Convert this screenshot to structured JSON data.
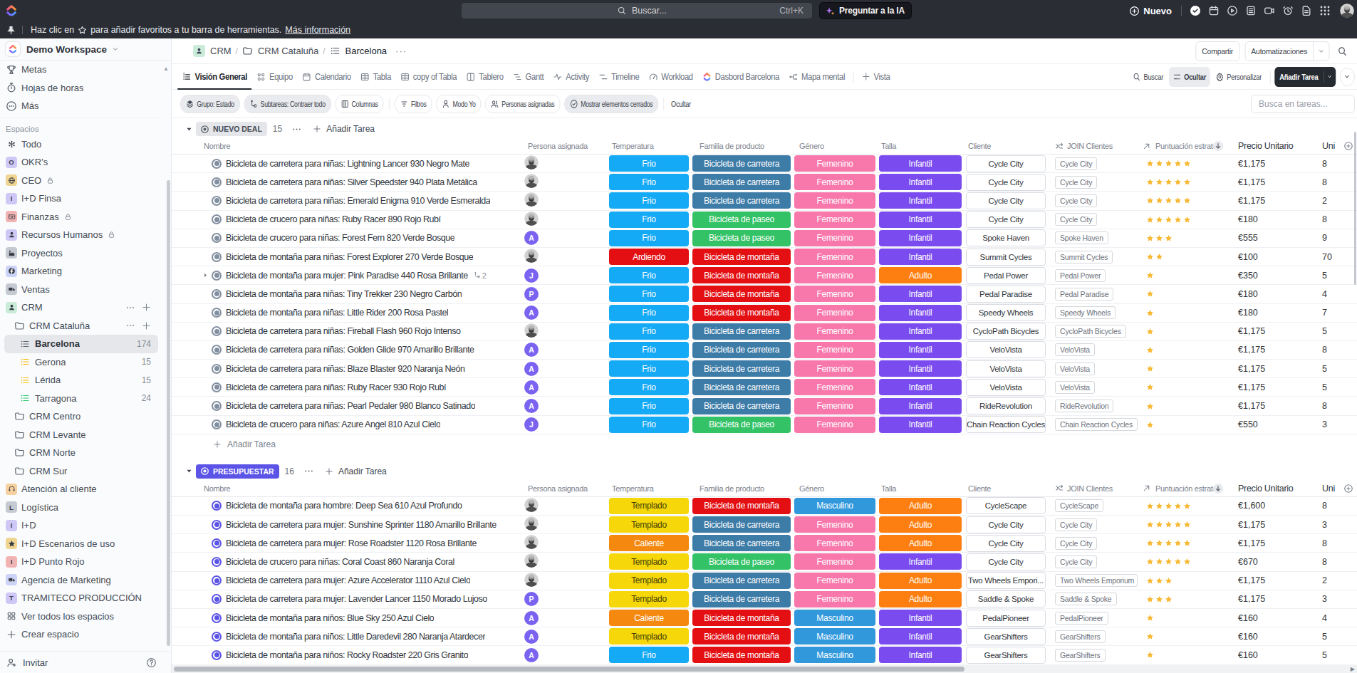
{
  "topbar": {
    "search_placeholder": "Buscar...",
    "search_shortcut": "Ctrl+K",
    "ask_ai_label": "Preguntar a la IA",
    "new_label": "Nuevo",
    "icons": [
      "check-circle-icon",
      "calendar-icon",
      "play-circle-icon",
      "notes-icon",
      "video-icon",
      "alarm-icon",
      "doc-icon",
      "grid-icon"
    ]
  },
  "favorites_bar": {
    "text_before_star": "Haz clic en",
    "text_after_star": "para añadir favoritos a tu barra de herramientas.",
    "link_label": "Más información"
  },
  "sidebar": {
    "workspace_name": "Demo Workspace",
    "top_items": [
      {
        "label": "Metas",
        "icon": "trophy"
      },
      {
        "label": "Hojas de horas",
        "icon": "stopwatch"
      },
      {
        "label": "Más",
        "icon": "dots-circle"
      }
    ],
    "section_label": "Espacios",
    "items": [
      {
        "type": "space",
        "label": "Todo",
        "icon": "everything"
      },
      {
        "type": "space",
        "label": "OKR's",
        "letter": "O",
        "bg": "#cfc8f6"
      },
      {
        "type": "space",
        "label": "CEO",
        "icon": "globe",
        "bg": "#f0d491",
        "lock": true
      },
      {
        "type": "space",
        "label": "I+D Finsa",
        "letter": "I",
        "bg": "#cfc8f6"
      },
      {
        "type": "space",
        "label": "Finanzas",
        "icon": "banknote",
        "bg": "#f2b3b3",
        "lock": true
      },
      {
        "type": "space",
        "label": "Recursos Humanos",
        "icon": "person",
        "bg": "#cfc8f6",
        "lock": true
      },
      {
        "type": "space",
        "label": "Proyectos",
        "icon": "factory",
        "bg": "#c4c9d2"
      },
      {
        "type": "space",
        "label": "Marketing",
        "icon": "facebook",
        "bg": "#ccd3f8"
      },
      {
        "type": "space",
        "label": "Ventas",
        "icon": "truck",
        "bg": "#c4c9d2"
      },
      {
        "type": "space",
        "label": "CRM",
        "icon": "person",
        "bg": "#c9ebd8",
        "actions": true
      },
      {
        "type": "folder",
        "label": "CRM Cataluña",
        "actions": true
      },
      {
        "type": "list",
        "label": "Barcelona",
        "count": "174",
        "color": "#5d646f",
        "selected": true
      },
      {
        "type": "list",
        "label": "Gerona",
        "count": "15",
        "color": "#f6b900"
      },
      {
        "type": "list",
        "label": "Lérida",
        "count": "15",
        "color": "#f6b900"
      },
      {
        "type": "list",
        "label": "Tarragona",
        "count": "24",
        "color": "#2cc56e"
      },
      {
        "type": "folder",
        "label": "CRM Centro"
      },
      {
        "type": "folder",
        "label": "CRM Levante"
      },
      {
        "type": "folder",
        "label": "CRM Norte"
      },
      {
        "type": "folder",
        "label": "CRM Sur"
      },
      {
        "type": "space",
        "label": "Atención al cliente",
        "icon": "headset",
        "bg": "#f6cf9e"
      },
      {
        "type": "space",
        "label": "Logística",
        "letter": "L",
        "bg": "#c4c9d2"
      },
      {
        "type": "space",
        "label": "I+D",
        "letter": "I",
        "bg": "#cfc8f6"
      },
      {
        "type": "space",
        "label": "I+D Escenarios de uso",
        "icon": "star",
        "bg": "#f0d491"
      },
      {
        "type": "space",
        "label": "I+D Punto Rojo",
        "letter": "I",
        "bg": "#f2b3b3"
      },
      {
        "type": "space",
        "label": "Agencia de Marketing",
        "icon": "truck",
        "bg": "#ccd3f8"
      },
      {
        "type": "space",
        "label": "TRAMITECO PRODUCCIÓN",
        "letter": "T",
        "bg": "#cfc8f6"
      },
      {
        "type": "action",
        "label": "Ver todos los espacios",
        "icon": "grid-small"
      },
      {
        "type": "action",
        "label": "Crear espacio",
        "icon": "plus"
      }
    ],
    "invite_label": "Invitar"
  },
  "breadcrumb": {
    "items": [
      {
        "label": "CRM",
        "icon": "person",
        "bg": "#c9ebd8"
      },
      {
        "label": "CRM Cataluña",
        "icon": "folder"
      },
      {
        "label": "Barcelona",
        "icon": "list"
      }
    ],
    "share_label": "Compartir",
    "automations_label": "Automatizaciones"
  },
  "tabs": [
    {
      "label": "Visión General",
      "icon": "overview",
      "active": true
    },
    {
      "label": "Equipo",
      "icon": "team"
    },
    {
      "label": "Calendario",
      "icon": "calendar"
    },
    {
      "label": "Tabla",
      "icon": "table"
    },
    {
      "label": "copy of Tabla",
      "icon": "table"
    },
    {
      "label": "Tablero",
      "icon": "board"
    },
    {
      "label": "Gantt",
      "icon": "gantt"
    },
    {
      "label": "Activity",
      "icon": "activity"
    },
    {
      "label": "Timeline",
      "icon": "timeline"
    },
    {
      "label": "Workload",
      "icon": "workload"
    },
    {
      "label": "Dasbord Barcelona",
      "icon": "clickup"
    },
    {
      "label": "Mapa mental",
      "icon": "mindmap"
    }
  ],
  "tabs_add_label": "Vista",
  "view_toolbar": {
    "search_label": "Buscar",
    "hide_label": "Ocultar",
    "customize_label": "Personalizar",
    "add_task_label": "Añadir Tarea"
  },
  "filter_bar": {
    "pills": [
      {
        "label": "Grupo: Estado",
        "icon": "layers",
        "grey": true
      },
      {
        "label": "Subtareas: Contraer todo",
        "icon": "subtask",
        "grey": true
      },
      {
        "label": "Columnas",
        "icon": "columns",
        "grey": false
      }
    ],
    "buttons": [
      {
        "label": "Filtros",
        "icon": "filter"
      },
      {
        "label": "Modo Yo",
        "icon": "person-o"
      },
      {
        "label": "Personas asignadas",
        "icon": "people"
      },
      {
        "label": "Mostrar elementos cerrados",
        "icon": "check-circle",
        "grey": true
      }
    ],
    "hide_label": "Ocultar",
    "task_search_placeholder": "Busca en tareas..."
  },
  "table": {
    "columns": [
      "Nombre",
      "Persona asignada",
      "Temperatura",
      "Familia de producto",
      "Género",
      "Talla",
      "Cliente",
      "JOIN Clientes",
      "Puntuación estraté...",
      "Precio Unitario",
      "Uni"
    ],
    "add_task_label": "Añadir Tarea",
    "pill_colors": {
      "Frio": "#15aaf5",
      "Ardiendo": "#e30f13",
      "Templado": "#f5d70a",
      "Caliente": "#f5880f",
      "Bicicleta de carretera": "#3e7ca8",
      "Bicicleta de paseo": "#33c266",
      "Bicicleta de montaña": "#e30f13",
      "Femenino": "#f878ac",
      "Masculino": "#3298dc",
      "Infantil": "#7a4bef",
      "Adulto": "#fd7f11"
    },
    "groups": [
      {
        "name": "NUEVO DEAL",
        "count": "15",
        "pill_bg": "#e4e6ea",
        "pill_fg": "#454c56",
        "status_color": "#828fa0",
        "rows": [
          {
            "name": "Bicicleta de carretera para niñas: Lightning Lancer 930 Negro Mate",
            "avatar": "photo",
            "temp": "Frio",
            "fam": "Bicicleta de carretera",
            "gen": "Femenino",
            "talla": "Infantil",
            "cliente": "Cycle City",
            "join": "Cycle City",
            "stars": 5,
            "precio": "€1,175",
            "uni": "8"
          },
          {
            "name": "Bicicleta de carretera para niñas: Silver Speedster 940 Plata Metálica",
            "avatar": "photo",
            "temp": "Frio",
            "fam": "Bicicleta de carretera",
            "gen": "Femenino",
            "talla": "Infantil",
            "cliente": "Cycle City",
            "join": "Cycle City",
            "stars": 5,
            "precio": "€1,175",
            "uni": "8"
          },
          {
            "name": "Bicicleta de carretera para niñas: Emerald Enigma 910 Verde Esmeralda",
            "avatar": "photo",
            "temp": "Frio",
            "fam": "Bicicleta de carretera",
            "gen": "Femenino",
            "talla": "Infantil",
            "cliente": "Cycle City",
            "join": "Cycle City",
            "stars": 5,
            "precio": "€1,175",
            "uni": "2"
          },
          {
            "name": "Bicicleta de crucero para niñas: Ruby Racer 890 Rojo Rubí",
            "avatar": "photo",
            "temp": "Frio",
            "fam": "Bicicleta de paseo",
            "gen": "Femenino",
            "talla": "Infantil",
            "cliente": "Cycle City",
            "join": "Cycle City",
            "stars": 5,
            "precio": "€180",
            "uni": "8"
          },
          {
            "name": "Bicicleta de crucero para niñas: Forest Fern 820 Verde Bosque",
            "avatar": "A",
            "temp": "Frio",
            "fam": "Bicicleta de paseo",
            "gen": "Femenino",
            "talla": "Infantil",
            "cliente": "Spoke Haven",
            "join": "Spoke Haven",
            "stars": 3,
            "precio": "€555",
            "uni": "9"
          },
          {
            "name": "Bicicleta de montaña para niñas: Forest Explorer 270 Verde Bosque",
            "avatar": "photo",
            "temp": "Ardiendo",
            "fam": "Bicicleta de montaña",
            "gen": "Femenino",
            "talla": "Infantil",
            "cliente": "Summit Cycles",
            "join": "Summit Cycles",
            "stars": 2,
            "precio": "€100",
            "uni": "70"
          },
          {
            "name": "Bicicleta de montaña para mujer: Pink Paradise 440 Rosa Brillante",
            "avatar": "J",
            "expand": true,
            "subtasks": "2",
            "temp": "Frio",
            "fam": "Bicicleta de montaña",
            "gen": "Femenino",
            "talla": "Adulto",
            "cliente": "Pedal Power",
            "join": "Pedal Power",
            "stars": 1,
            "precio": "€350",
            "uni": "5"
          },
          {
            "name": "Bicicleta de montaña para niñas: Tiny Trekker 230 Negro Carbón",
            "avatar": "P",
            "temp": "Frio",
            "fam": "Bicicleta de montaña",
            "gen": "Femenino",
            "talla": "Infantil",
            "cliente": "Pedal Paradise",
            "join": "Pedal Paradise",
            "stars": 1,
            "precio": "€180",
            "uni": "4"
          },
          {
            "name": "Bicicleta de montaña para niñas: Little Rider 200 Rosa Pastel",
            "avatar": "A",
            "temp": "Frio",
            "fam": "Bicicleta de montaña",
            "gen": "Femenino",
            "talla": "Infantil",
            "cliente": "Speedy Wheels",
            "join": "Speedy Wheels",
            "stars": 1,
            "precio": "€180",
            "uni": "7"
          },
          {
            "name": "Bicicleta de carretera para niñas: Fireball Flash 960 Rojo Intenso",
            "avatar": "photo",
            "temp": "Frio",
            "fam": "Bicicleta de carretera",
            "gen": "Femenino",
            "talla": "Infantil",
            "cliente": "CycloPath Bicycles",
            "join": "CycloPath Bicycles",
            "stars": 1,
            "precio": "€1,175",
            "uni": "5"
          },
          {
            "name": "Bicicleta de carretera para niñas: Golden Glide 970 Amarillo Brillante",
            "avatar": "A",
            "temp": "Frio",
            "fam": "Bicicleta de carretera",
            "gen": "Femenino",
            "talla": "Infantil",
            "cliente": "VeloVista",
            "join": "VeloVista",
            "stars": 1,
            "precio": "€1,175",
            "uni": "8"
          },
          {
            "name": "Bicicleta de carretera para niñas: Blaze Blaster 920 Naranja Neón",
            "avatar": "A",
            "temp": "Frio",
            "fam": "Bicicleta de carretera",
            "gen": "Femenino",
            "talla": "Infantil",
            "cliente": "VeloVista",
            "join": "VeloVista",
            "stars": 1,
            "precio": "€1,175",
            "uni": "5"
          },
          {
            "name": "Bicicleta de carretera para niñas: Ruby Racer 930 Rojo Rubí",
            "avatar": "A",
            "temp": "Frio",
            "fam": "Bicicleta de carretera",
            "gen": "Femenino",
            "talla": "Infantil",
            "cliente": "VeloVista",
            "join": "VeloVista",
            "stars": 1,
            "precio": "€1,175",
            "uni": "5"
          },
          {
            "name": "Bicicleta de carretera para niñas: Pearl Pedaler 980 Blanco Satinado",
            "avatar": "A",
            "temp": "Frio",
            "fam": "Bicicleta de carretera",
            "gen": "Femenino",
            "talla": "Infantil",
            "cliente": "RideRevolution",
            "join": "RideRevolution",
            "stars": 1,
            "precio": "€1,175",
            "uni": "8"
          },
          {
            "name": "Bicicleta de crucero para niñas: Azure Angel 810 Azul Cielo",
            "avatar": "J",
            "temp": "Frio",
            "fam": "Bicicleta de paseo",
            "gen": "Femenino",
            "talla": "Infantil",
            "cliente": "Chain Reaction Cycles",
            "join": "Chain Reaction Cycles",
            "stars": 1,
            "precio": "€550",
            "uni": "3"
          }
        ]
      },
      {
        "name": "PRESUPUESTAR",
        "count": "16",
        "pill_bg": "#5b54e6",
        "pill_fg": "#ffffff",
        "status_color": "#5b54e6",
        "rows": [
          {
            "name": "Bicicleta de montaña para hombre: Deep Sea 610 Azul Profundo",
            "avatar": "photo",
            "temp": "Templado",
            "fam": "Bicicleta de montaña",
            "gen": "Masculino",
            "talla": "Adulto",
            "cliente": "CycleScape",
            "join": "CycleScape",
            "stars": 5,
            "precio": "€1,600",
            "uni": "8"
          },
          {
            "name": "Bicicleta de carretera para mujer: Sunshine Sprinter 1180 Amarillo Brillante",
            "avatar": "photo",
            "temp": "Templado",
            "fam": "Bicicleta de carretera",
            "gen": "Femenino",
            "talla": "Adulto",
            "cliente": "Cycle City",
            "join": "Cycle City",
            "stars": 5,
            "precio": "€1,175",
            "uni": "3"
          },
          {
            "name": "Bicicleta de carretera para mujer: Rose Roadster 1120 Rosa Brillante",
            "avatar": "photo",
            "temp": "Caliente",
            "fam": "Bicicleta de carretera",
            "gen": "Femenino",
            "talla": "Adulto",
            "cliente": "Cycle City",
            "join": "Cycle City",
            "stars": 5,
            "precio": "€1,175",
            "uni": "8"
          },
          {
            "name": "Bicicleta de crucero para niñas: Coral Coast 860 Naranja Coral",
            "avatar": "photo",
            "temp": "Templado",
            "fam": "Bicicleta de paseo",
            "gen": "Femenino",
            "talla": "Infantil",
            "cliente": "Cycle City",
            "join": "Cycle City",
            "stars": 5,
            "precio": "€670",
            "uni": "8"
          },
          {
            "name": "Bicicleta de carretera para mujer: Azure Accelerator 1110 Azul Cielo",
            "avatar": "photo",
            "temp": "Templado",
            "fam": "Bicicleta de carretera",
            "gen": "Femenino",
            "talla": "Adulto",
            "cliente": "Two Wheels Empori...",
            "join": "Two Wheels Emporium",
            "stars": 3,
            "precio": "€1,175",
            "uni": "2"
          },
          {
            "name": "Bicicleta de carretera para mujer: Lavender Lancer 1150 Morado Lujoso",
            "avatar": "P",
            "temp": "Templado",
            "fam": "Bicicleta de carretera",
            "gen": "Femenino",
            "talla": "Adulto",
            "cliente": "Saddle & Spoke",
            "join": "Saddle & Spoke",
            "stars": 3,
            "precio": "€1,175",
            "uni": "3"
          },
          {
            "name": "Bicicleta de montaña para niños: Blue Sky 250 Azul Cielo",
            "avatar": "A",
            "temp": "Caliente",
            "fam": "Bicicleta de montaña",
            "gen": "Masculino",
            "talla": "Infantil",
            "cliente": "PedalPioneer",
            "join": "PedalPioneer",
            "stars": 1,
            "precio": "€160",
            "uni": "4"
          },
          {
            "name": "Bicicleta de montaña para niños: Little Daredevil 280 Naranja Atardecer",
            "avatar": "A",
            "temp": "Templado",
            "fam": "Bicicleta de montaña",
            "gen": "Masculino",
            "talla": "Infantil",
            "cliente": "GearShifters",
            "join": "GearShifters",
            "stars": 1,
            "precio": "€160",
            "uni": "5"
          },
          {
            "name": "Bicicleta de montaña para niños: Rocky Roadster 220 Gris Granito",
            "avatar": "A",
            "temp": "Frio",
            "fam": "Bicicleta de montaña",
            "gen": "Masculino",
            "talla": "Infantil",
            "cliente": "GearShifters",
            "join": "GearShifters",
            "stars": 1,
            "precio": "€160",
            "uni": "5"
          }
        ]
      }
    ]
  }
}
